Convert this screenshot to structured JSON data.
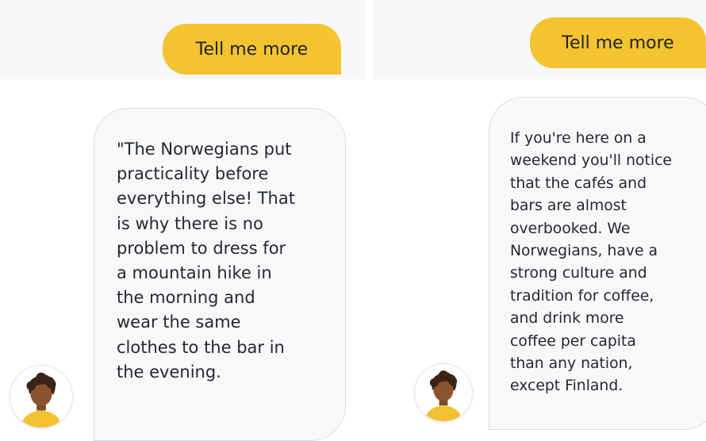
{
  "conversations": [
    {
      "reply_chip": "Tell me more",
      "message": "\"The Norwegians put\npracticality before\neverything else! That\nis why there is no\nproblem to dress for\na mountain hike in\nthe morning and\nwear the same\nclothes to the bar in\nthe evening."
    },
    {
      "reply_chip": "Tell me more",
      "message": "If you're here on a\nweekend you'll notice\nthat the cafés and\nbars are almost\noverbooked. We\nNorwegians, have a\nstrong culture and\ntradition for coffee,\nand drink more\ncoffee per capita\nthan any nation,\nexcept Finland."
    }
  ],
  "colors": {
    "accent_yellow": "#f4c330",
    "bubble_bg": "#f7f8fa",
    "text": "#24282d"
  },
  "icons": {
    "avatar": "person-avatar-icon"
  }
}
